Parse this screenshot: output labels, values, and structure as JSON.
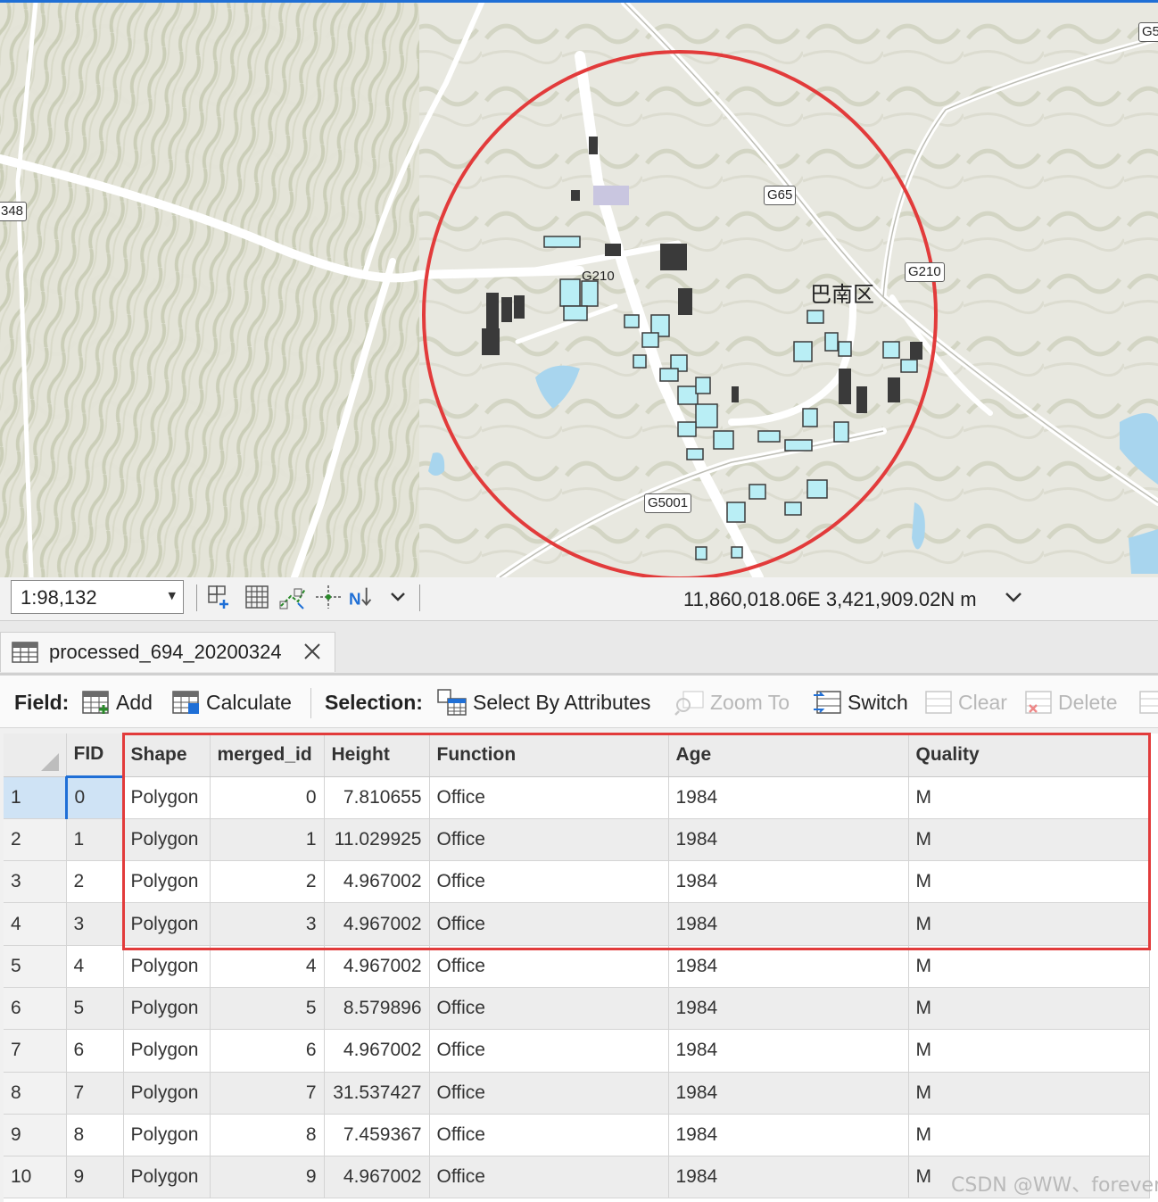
{
  "map": {
    "road_labels": [
      "G5",
      "G65",
      "G210",
      "G210",
      "G5001",
      "348"
    ],
    "place_label": "巴南区",
    "colors": {
      "buildings": "#b9eef5",
      "buildings_outline": "#3a3a3a",
      "roads": "#ffffff",
      "water": "#a8d5ee",
      "annotation_circle": "#e23b3b"
    }
  },
  "status_bar": {
    "scale": "1:98,132",
    "coordinates": "11,860,018.06E 3,421,909.02N m",
    "icons": [
      "add-grid-icon",
      "grid-icon",
      "snapping-icon",
      "constraints-icon",
      "north-arrow-icon",
      "chevron-down-icon"
    ]
  },
  "tab": {
    "title": "processed_694_20200324"
  },
  "toolbar": {
    "field_label": "Field:",
    "add_label": "Add",
    "calculate_label": "Calculate",
    "selection_label": "Selection:",
    "select_by_attributes_label": "Select By Attributes",
    "zoom_to_label": "Zoom To",
    "switch_label": "Switch",
    "clear_label": "Clear",
    "delete_label": "Delete"
  },
  "table": {
    "columns": [
      "FID",
      "Shape",
      "merged_id",
      "Height",
      "Function",
      "Age",
      "Quality"
    ],
    "rows": [
      {
        "n": "1",
        "fid": "0",
        "shape": "Polygon",
        "merged_id": "0",
        "height": "7.810655",
        "function": "Office",
        "age": "1984",
        "quality": "M"
      },
      {
        "n": "2",
        "fid": "1",
        "shape": "Polygon",
        "merged_id": "1",
        "height": "11.029925",
        "function": "Office",
        "age": "1984",
        "quality": "M"
      },
      {
        "n": "3",
        "fid": "2",
        "shape": "Polygon",
        "merged_id": "2",
        "height": "4.967002",
        "function": "Office",
        "age": "1984",
        "quality": "M"
      },
      {
        "n": "4",
        "fid": "3",
        "shape": "Polygon",
        "merged_id": "3",
        "height": "4.967002",
        "function": "Office",
        "age": "1984",
        "quality": "M"
      },
      {
        "n": "5",
        "fid": "4",
        "shape": "Polygon",
        "merged_id": "4",
        "height": "4.967002",
        "function": "Office",
        "age": "1984",
        "quality": "M"
      },
      {
        "n": "6",
        "fid": "5",
        "shape": "Polygon",
        "merged_id": "5",
        "height": "8.579896",
        "function": "Office",
        "age": "1984",
        "quality": "M"
      },
      {
        "n": "7",
        "fid": "6",
        "shape": "Polygon",
        "merged_id": "6",
        "height": "4.967002",
        "function": "Office",
        "age": "1984",
        "quality": "M"
      },
      {
        "n": "8",
        "fid": "7",
        "shape": "Polygon",
        "merged_id": "7",
        "height": "31.537427",
        "function": "Office",
        "age": "1984",
        "quality": "M"
      },
      {
        "n": "9",
        "fid": "8",
        "shape": "Polygon",
        "merged_id": "8",
        "height": "7.459367",
        "function": "Office",
        "age": "1984",
        "quality": "M"
      },
      {
        "n": "10",
        "fid": "9",
        "shape": "Polygon",
        "merged_id": "9",
        "height": "4.967002",
        "function": "Office",
        "age": "1984",
        "quality": "M"
      }
    ]
  },
  "watermark": "CSDN @WW、forever"
}
